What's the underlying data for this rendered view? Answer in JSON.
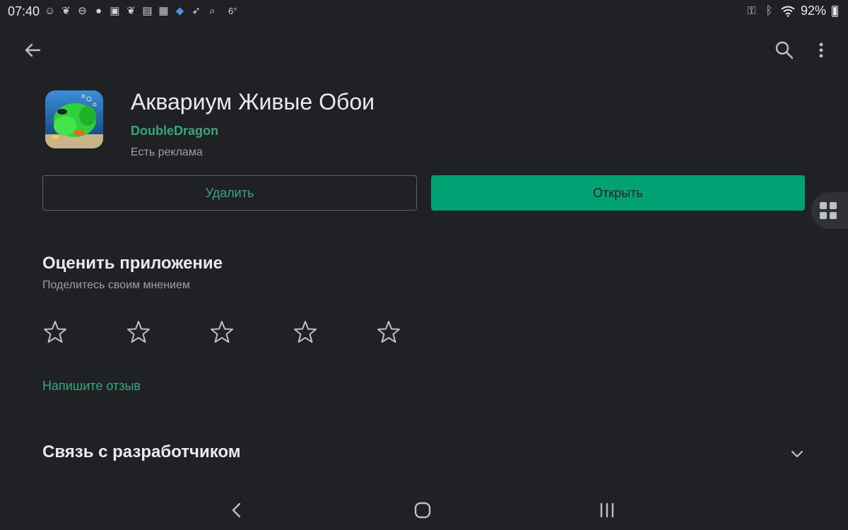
{
  "status_bar": {
    "time": "07:40",
    "temperature": "6°",
    "battery": "92%",
    "icons": [
      "emoji-icon",
      "leaf-icon",
      "dnd-icon",
      "apple-icon",
      "gallery-icon",
      "leaf-icon",
      "translate-icon",
      "news-icon",
      "vpn-icon",
      "rocket-icon",
      "search-icon"
    ]
  },
  "app": {
    "title": "Аквариум Живые Обои",
    "developer": "DoubleDragon",
    "ads_note": "Есть реклама"
  },
  "buttons": {
    "uninstall": "Удалить",
    "open": "Открыть"
  },
  "rate": {
    "title": "Оценить приложение",
    "subtitle": "Поделитесь своим мнением",
    "stars_total": 5,
    "stars_filled": 0,
    "write_review": "Напишите отзыв"
  },
  "contact": {
    "title": "Связь с разработчиком"
  },
  "colors": {
    "accent": "#34a87a",
    "open_button": "#00a173",
    "background": "#202124"
  }
}
